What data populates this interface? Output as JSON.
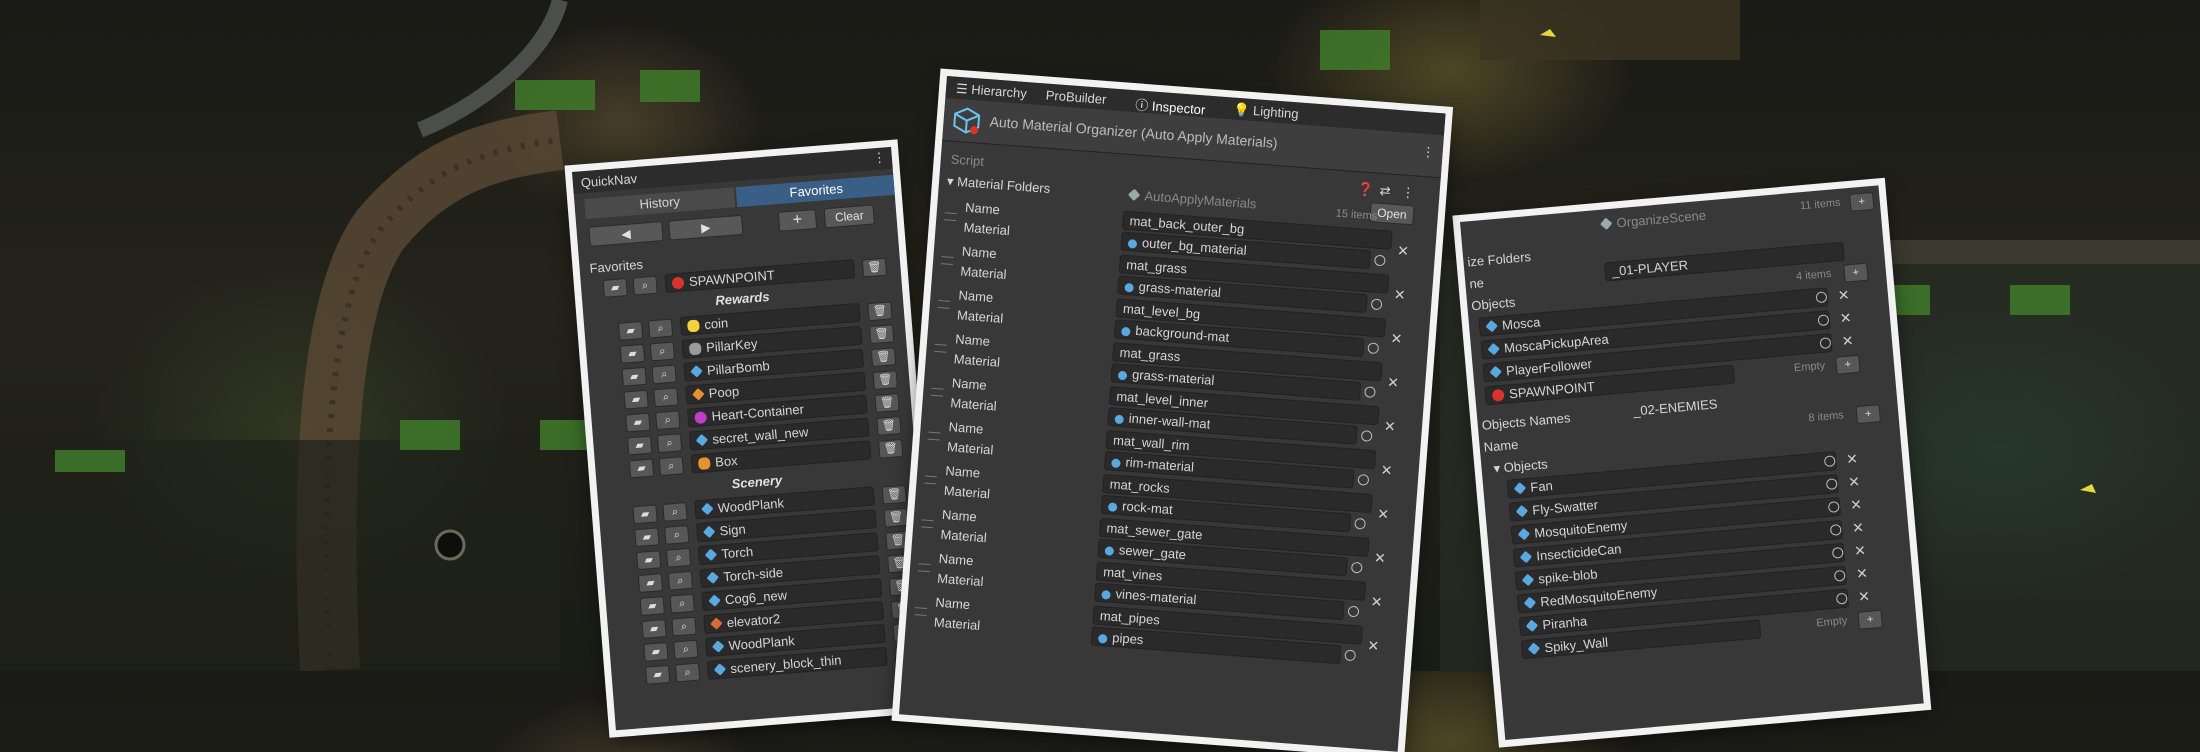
{
  "quicknav": {
    "window_title": "QuickNav",
    "tabs": [
      "History",
      "Favorites"
    ],
    "clear_label": "Clear",
    "favorites_label": "Favorites",
    "spawnpoint": "SPAWNPOINT",
    "section_rewards": "Rewards",
    "rewards": [
      "coin",
      "PillarKey",
      "PillarBomb",
      "Poop",
      "Heart-Container",
      "secret_wall_new",
      "Box"
    ],
    "section_scenery": "Scenery",
    "scenery": [
      "WoodPlank",
      "Sign",
      "Torch",
      "Torch-side",
      "Cog6_new",
      "elevator2",
      "WoodPlank",
      "scenery_block_thin"
    ]
  },
  "inspector": {
    "tabs": [
      "Hierarchy",
      "ProBuilder",
      "Inspector",
      "Lighting"
    ],
    "component_title": "Auto Material Organizer (Auto Apply Materials)",
    "script_label": "Script",
    "script_value": "AutoApplyMaterials",
    "open_label": "Open",
    "folders_label": "Material Folders",
    "items_count": "15 items",
    "name_label": "Name",
    "material_label": "Material",
    "entries": [
      {
        "name": "mat_back_outer_bg",
        "material": "outer_bg_material"
      },
      {
        "name": "mat_grass",
        "material": "grass-material"
      },
      {
        "name": "mat_level_bg",
        "material": "background-mat"
      },
      {
        "name": "mat_grass",
        "material": "grass-material"
      },
      {
        "name": "mat_level_inner",
        "material": "inner-wall-mat"
      },
      {
        "name": "mat_wall_rim",
        "material": "rim-material"
      },
      {
        "name": "mat_rocks",
        "material": "rock-mat"
      },
      {
        "name": "mat_sewer_gate",
        "material": "sewer_gate"
      },
      {
        "name": "mat_vines",
        "material": "vines-material"
      },
      {
        "name": "mat_pipes",
        "material": "pipes"
      }
    ]
  },
  "organize": {
    "script_value": "OrganizeScene",
    "top_count": "11 items",
    "folders_label": "ize Folders",
    "name_label_partial": "ne",
    "name_label": "Name",
    "player_folder": "_01-PLAYER",
    "player_count": "4 items",
    "objects_label": "Objects",
    "player_objects": [
      "Mosca",
      "MoscaPickupArea",
      "PlayerFollower",
      "SPAWNPOINT"
    ],
    "empty_label": "Empty",
    "objects_names_label": "Objects Names",
    "enemies_folder": "_02-ENEMIES",
    "enemies_count": "8 items",
    "enemy_objects": [
      "Fan",
      "Fly-Swatter",
      "MosquitoEnemy",
      "InsecticideCan",
      "spike-blob",
      "RedMosquitoEnemy",
      "Piranha",
      "Spiky_Wall"
    ]
  },
  "colors": {
    "panel_bg": "#383838",
    "tab_active": "#3a5f86",
    "spawn_red": "#d8342c",
    "coin_yellow": "#f2d43a",
    "prefab_blue": "#5aa8e0"
  }
}
